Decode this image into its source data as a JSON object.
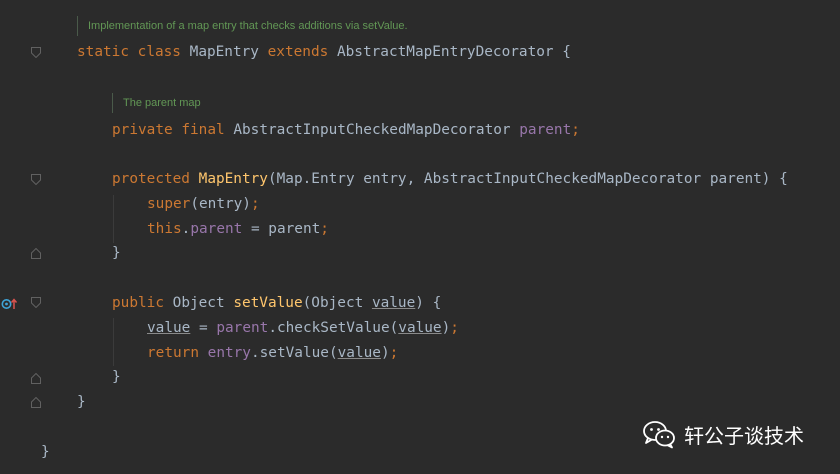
{
  "editor": {
    "doc_class": "Implementation of a map entry that checks additions via setValue.",
    "doc_parent": "The parent map",
    "lines": {
      "l1": [
        "static",
        "class",
        "MapEntry",
        "extends",
        "AbstractMapEntryDecorator {"
      ],
      "l2": [
        "private",
        "final",
        "AbstractInputCheckedMapDecorator",
        "parent",
        ";"
      ],
      "l3": [
        "protected",
        "MapEntry",
        "(Map.Entry entry, AbstractInputCheckedMapDecorator parent) {"
      ],
      "l4": [
        "super",
        "(entry)",
        ";"
      ],
      "l5": [
        "this",
        ".",
        "parent",
        " = parent",
        ";"
      ],
      "l6": "}",
      "l7": [
        "public",
        "Object",
        "setValue",
        "(Object ",
        "value",
        ") {"
      ],
      "l8": [
        "value",
        " = ",
        "parent",
        ".checkSetValue(",
        "value",
        ")",
        ";"
      ],
      "l9": [
        "return",
        "entry",
        ".setValue(",
        "value",
        ")",
        ";"
      ],
      "l10": "}",
      "l11": "}",
      "l12": "}"
    },
    "colors": {
      "background": "#2b2b2b",
      "keyword": "#cc7832",
      "field": "#9876aa",
      "method": "#ffc66d",
      "text": "#a9b7c6",
      "doc": "#629755"
    },
    "gutter_icons": [
      "override-method-icon",
      "up-arrow-icon"
    ]
  },
  "watermark": {
    "icon": "wechat-icon",
    "text": "轩公子谈技术"
  }
}
